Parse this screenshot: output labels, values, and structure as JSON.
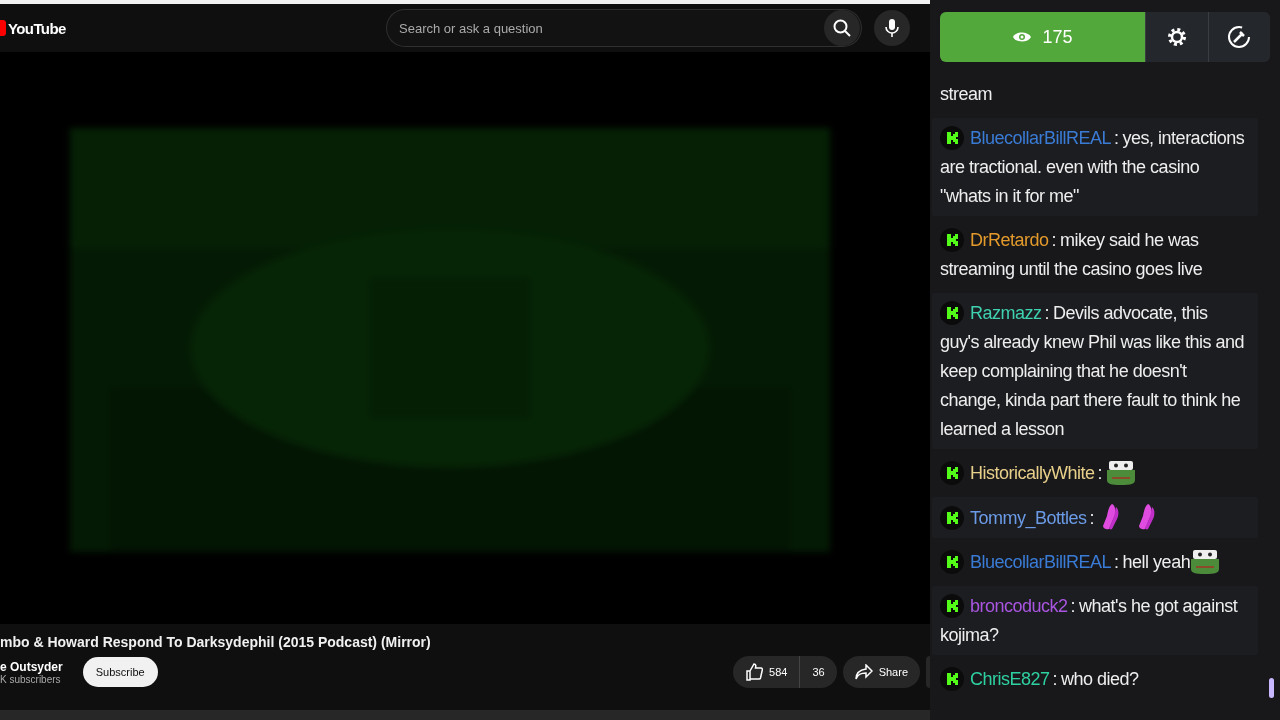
{
  "player": {
    "logo": "YouTube",
    "search": {
      "placeholder": "Search or ask a question"
    },
    "title": "mbo & Howard Respond To Darksydephil (2015 Podcast) (Mirror)",
    "channel": "e Outsyder",
    "subscribers": "K subscribers",
    "subscribe": "Subscribe",
    "likes": "584",
    "dislikes": "36",
    "share": "Share"
  },
  "chat": {
    "viewers": "175",
    "messages": [
      {
        "kind": "continuation",
        "parts": [
          {
            "kind": "text",
            "text": "stream"
          }
        ]
      },
      {
        "kind": "message",
        "user": "BluecollarBillREAL",
        "color": "#3a7bd5",
        "separator": ":",
        "parts": [
          {
            "kind": "text",
            "text": "yes, interactions are tractional. even with the casino \"whats in it for me\""
          }
        ]
      },
      {
        "kind": "message",
        "user": "DrRetardo",
        "color": "#e39a2b",
        "separator": ":",
        "parts": [
          {
            "kind": "text",
            "text": "mikey said he was streaming until the casino goes live"
          }
        ]
      },
      {
        "kind": "message",
        "user": "Razmazz",
        "color": "#3fd1b0",
        "separator": ":",
        "parts": [
          {
            "kind": "text",
            "text": "Devils advocate, this guy's already knew Phil was like this and keep complaining that he doesn't change, kinda part there fault to think he learned a lesson"
          }
        ]
      },
      {
        "kind": "message",
        "user": "HistoricallyWhite",
        "color": "#e8cf8a",
        "separator": ":",
        "parts": [
          {
            "kind": "frog-emote"
          }
        ]
      },
      {
        "kind": "message",
        "user": "Tommy_Bottles",
        "color": "#6b9be6",
        "separator": ":",
        "parts": [
          {
            "kind": "hands-emote"
          },
          {
            "kind": "hands-emote"
          }
        ]
      },
      {
        "kind": "message",
        "user": "BluecollarBillREAL",
        "color": "#3a7bd5",
        "separator": ":",
        "parts": [
          {
            "kind": "text",
            "text": "hell yeah"
          },
          {
            "kind": "frog-emote"
          }
        ]
      },
      {
        "kind": "message",
        "user": "broncoduck2",
        "color": "#a855e0",
        "separator": ":",
        "parts": [
          {
            "kind": "text",
            "text": "what's he got against kojima?"
          }
        ]
      },
      {
        "kind": "message",
        "user": "ChrisE827",
        "color": "#2fd0a0",
        "separator": ":",
        "parts": [
          {
            "kind": "text",
            "text": "who died?"
          }
        ]
      }
    ]
  }
}
